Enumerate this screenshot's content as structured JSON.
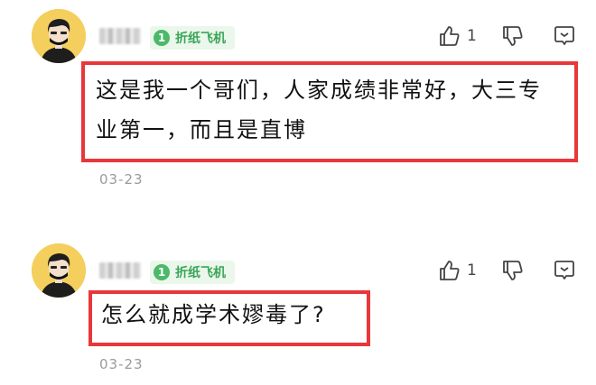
{
  "comments": [
    {
      "badge": {
        "level": "1",
        "label": "折纸飞机"
      },
      "content": "这是我一个哥们，人家成绩非常好，大三专业第一，而且是直博",
      "like_count": "1",
      "date": "03-23"
    },
    {
      "badge": {
        "level": "1",
        "label": "折纸飞机"
      },
      "content": "怎么就成学术嫪毒了?",
      "like_count": "1",
      "date": "03-23"
    }
  ],
  "colors": {
    "highlight_border": "#e8373a",
    "badge_green": "#4cb96a",
    "avatar_bg": "#f4cf5d"
  },
  "icons": [
    "thumbs-up-icon",
    "thumbs-down-icon",
    "more-icon"
  ]
}
